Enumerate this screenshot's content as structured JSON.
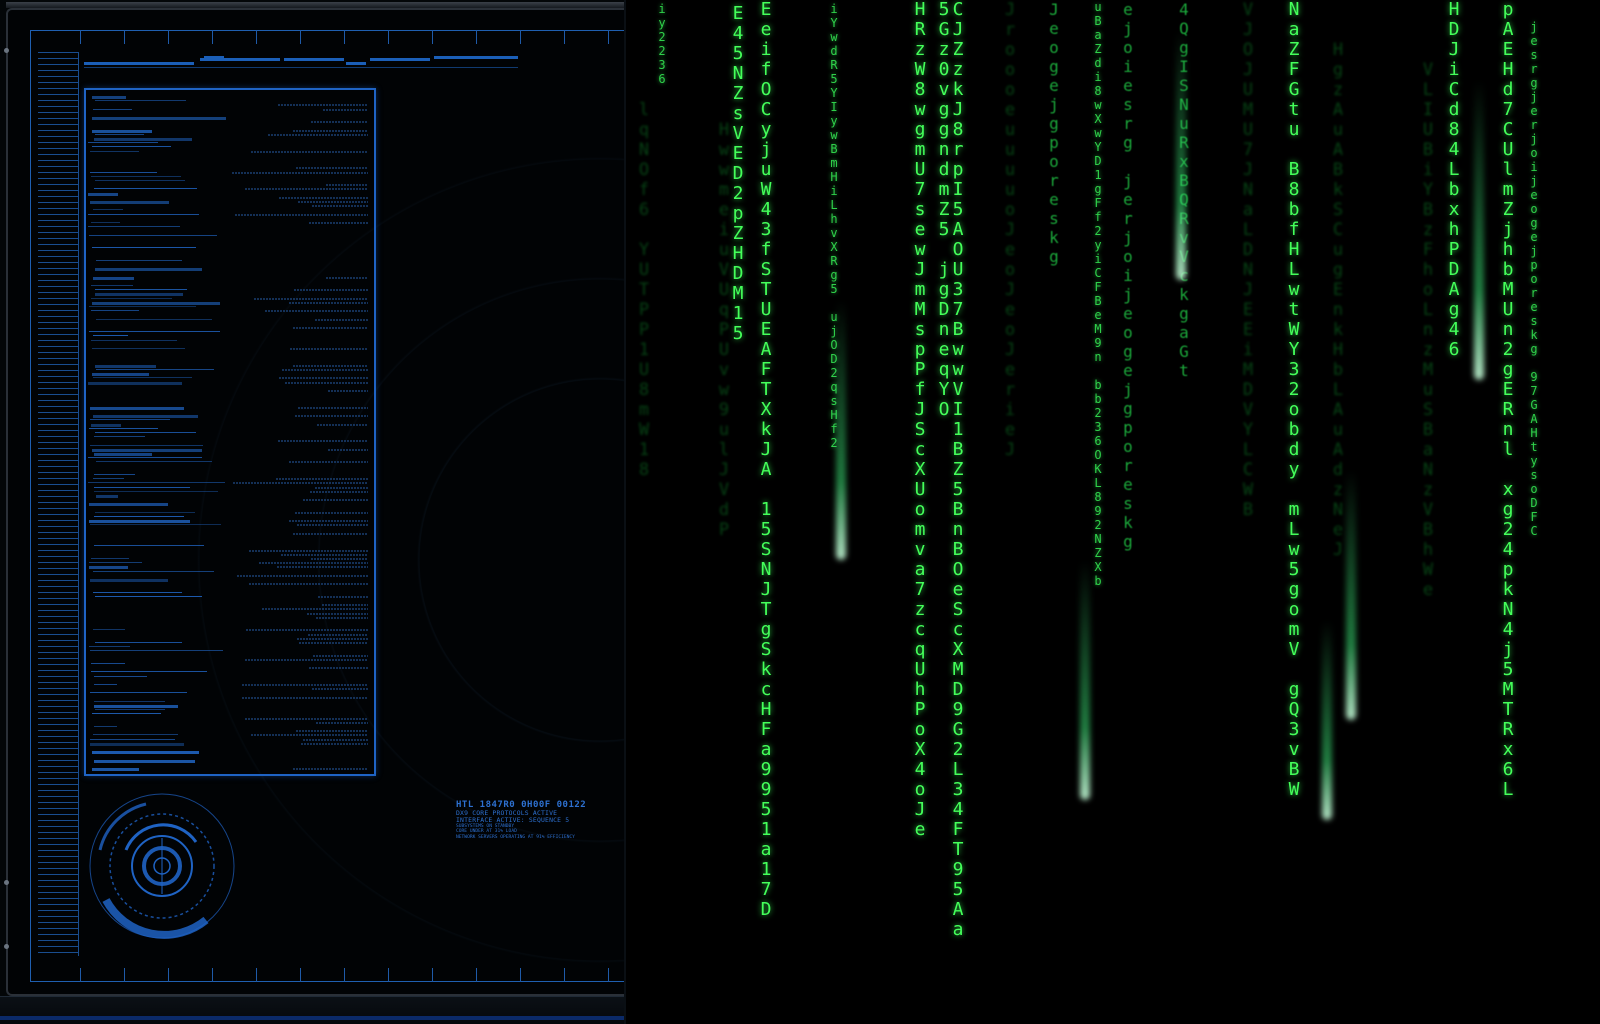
{
  "hud": {
    "readout": {
      "title": "HTL 1847R0   0H00F 00122",
      "lines": [
        "DX9 CORE PROTOCOLS ACTIVE",
        "INTERFACE ACTIVE: SEQUENCE 5"
      ],
      "tiny_lines": [
        "SUBSYSTEMS ON STANDBY",
        "CORE UNDER AT 31% LOAD",
        "NETWORK SERVERS OPERATING AT 91% EFFICIENCY"
      ]
    },
    "colors": {
      "accent": "#1f63c4",
      "frame": "#1e5aa8",
      "background": "#010305"
    }
  },
  "matrix": {
    "colors": {
      "bright": "#44ff5a",
      "mid": "#1ba63a",
      "dim": "#0a5a1c"
    },
    "columns": [
      {
        "depth": "small",
        "text": "iy2236"
      },
      {
        "depth": "far",
        "text": "lqNOf6 YUTPP1U8mW18"
      },
      {
        "depth": "far",
        "text": "HwwmeiuVUqPUvw9ulJVdP"
      },
      {
        "depth": "near",
        "text": "E45NZsVED2pZHDM15"
      },
      {
        "depth": "near",
        "text": "EeifOCyjuW43fSTUEAFTXkJA 15SNJTgSkcHFa9951a17D"
      },
      {
        "depth": "small",
        "text": "iYwdR5YIywBmHiLhvXRg5 ujOD2qsHf2"
      },
      {
        "depth": "near",
        "text": "HRzW8wgmU7sewJmMspPfJScXUomva7zcqUhPoX4oJe"
      },
      {
        "depth": "near",
        "text": "5Gz0vggndmZ5 jgDneqYO"
      },
      {
        "depth": "near",
        "text": "CJZzkJ8rpI5AOU37BwwVI1BZ5BnBOeScXMD9G2L34FT95Aa"
      },
      {
        "depth": "far",
        "text": "JroooeuuuuoJeoJeoJerieJ"
      },
      {
        "depth": "mid",
        "text": "Jeogejgporeskg"
      },
      {
        "depth": "small",
        "text": "uBaZdi8wXwYD1gFf2yiCFBeM9n bb236OKL892NZXb"
      },
      {
        "depth": "mid",
        "text": "ejoiesrg jerjoijeogejgporeskg"
      },
      {
        "depth": "mid",
        "text": "4QgISNuRxBQRvVckgaGt"
      },
      {
        "depth": "far",
        "text": "VJOJUMU7JNaLDNJEEiMDVYLCWB"
      },
      {
        "depth": "near",
        "text": "NaZFGtu B8bfHLwtWY32obdy mLw5gomV gQ3vBW"
      },
      {
        "depth": "far",
        "text": "HgzAuABkSCugEnkHbLAuAdzNeJ"
      },
      {
        "depth": "near",
        "text": "HDJiCd84LbxhPDAg46"
      },
      {
        "depth": "far",
        "text": "VLIUBiYBzFhoLnzMuSBaNzVBhWe"
      },
      {
        "depth": "near",
        "text": "pAEHd7CUlmZjhbMUn2gERnl xg24pkN4j5MTRx6L"
      },
      {
        "depth": "small",
        "text": "jesrgjerjoijeogejporeskg 97GAHtysoDFC"
      }
    ]
  }
}
